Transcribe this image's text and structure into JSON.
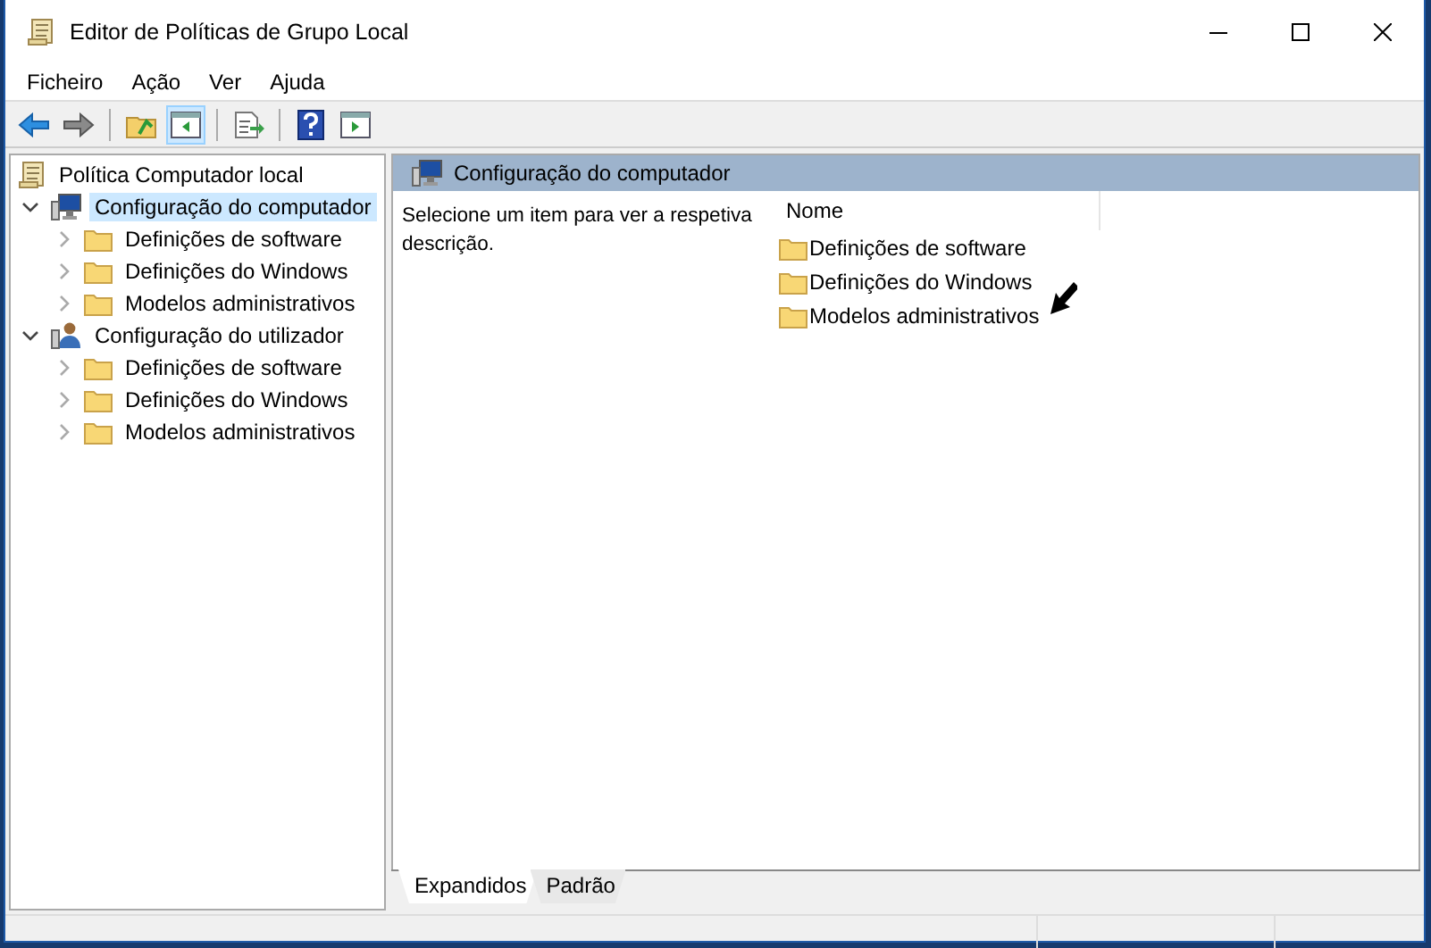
{
  "window": {
    "title": "Editor de Políticas de Grupo Local"
  },
  "menu": [
    "Ficheiro",
    "Ação",
    "Ver",
    "Ajuda"
  ],
  "toolbar": [
    {
      "kind": "back",
      "pressed": false
    },
    {
      "kind": "forward",
      "pressed": false
    },
    {
      "kind": "sep"
    },
    {
      "kind": "up",
      "pressed": false
    },
    {
      "kind": "tree",
      "pressed": true
    },
    {
      "kind": "sep"
    },
    {
      "kind": "export",
      "pressed": false
    },
    {
      "kind": "sep"
    },
    {
      "kind": "help",
      "pressed": false
    },
    {
      "kind": "actions",
      "pressed": false
    }
  ],
  "tree": [
    {
      "label": "Política Computador local",
      "kind": "policy",
      "children": [
        {
          "label": "Configuração do computador",
          "kind": "computer",
          "expanded": true,
          "selected": true,
          "children": [
            {
              "label": "Definições de software",
              "kind": "folder",
              "expanded": false,
              "selected": false
            },
            {
              "label": "Definições do Windows",
              "kind": "folder",
              "expanded": false,
              "selected": false
            },
            {
              "label": "Modelos administrativos",
              "kind": "folder",
              "expanded": false,
              "selected": false
            }
          ]
        },
        {
          "label": "Configuração do utilizador",
          "kind": "user",
          "expanded": true,
          "selected": false,
          "children": [
            {
              "label": "Definições de software",
              "kind": "folder",
              "expanded": false,
              "selected": false
            },
            {
              "label": "Definições do Windows",
              "kind": "folder",
              "expanded": false,
              "selected": false
            },
            {
              "label": "Modelos administrativos",
              "kind": "folder",
              "expanded": false,
              "selected": false
            }
          ]
        }
      ]
    }
  ],
  "detail": {
    "title": "Configuração do computador",
    "description": "Selecione um item para ver a respetiva descrição.",
    "column": "Nome",
    "items": [
      "Definições de software",
      "Definições do Windows",
      "Modelos administrativos"
    ]
  },
  "tabs": [
    {
      "label": "Expandidos",
      "selected": true
    },
    {
      "label": "Padrão",
      "selected": false
    }
  ]
}
